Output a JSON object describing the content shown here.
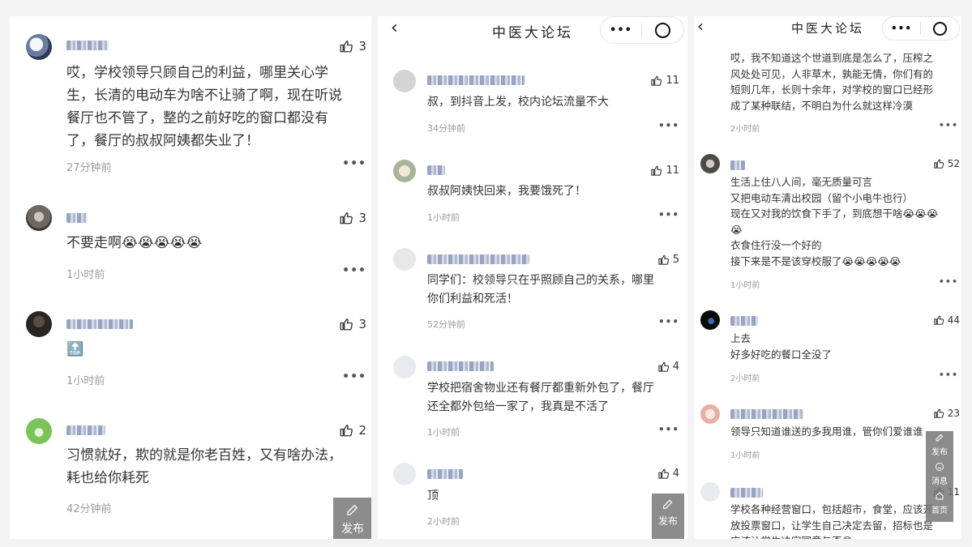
{
  "panel1": {
    "comments": [
      {
        "likes": "3",
        "text": "哎，学校领导只顾自己的利益，哪里关心学\n生，长清的电动车为啥不让骑了啊，现在听说\n餐厅也不管了，整的之前好吃的窗口都没有\n了，餐厅的叔叔阿姨都失业了！",
        "time": "27分钟前"
      },
      {
        "likes": "3",
        "text": "不要走啊😭😭😭😭😭",
        "time": "1小时前"
      },
      {
        "likes": "3",
        "text": "🔝",
        "time": "1小时前"
      },
      {
        "likes": "2",
        "text": "习惯就好，欺的就是你老百姓，又有啥办法，\n耗也给你耗死",
        "time": "42分钟前"
      }
    ],
    "fab": {
      "label": "发布"
    }
  },
  "panel2": {
    "title": "中医大论坛",
    "comments": [
      {
        "likes": "11",
        "text": "叔，到抖音上发，校内论坛流量不大",
        "time": "34分钟前"
      },
      {
        "likes": "11",
        "text": "叔叔阿姨快回来，我要饿死了！",
        "time": "1小时前"
      },
      {
        "likes": "5",
        "text": "同学们：校领导只在乎照顾自己的关系，哪里\n你们利益和死活！",
        "time": "52分钟前"
      },
      {
        "likes": "4",
        "text": "学校把宿舍物业还有餐厅都重新外包了，餐厅\n还全都外包给一家了，我真是不活了",
        "time": "1小时前"
      },
      {
        "likes": "4",
        "text": "顶",
        "time": "2小时前"
      }
    ],
    "fab": {
      "label": "发布"
    }
  },
  "panel3": {
    "title": "中医大论坛",
    "comments": [
      {
        "likes": "",
        "text": "哎，我不知道这个世道到底是怎么了，压榨之\n风处处可见，人非草木，孰能无情，你们有的\n短则几年，长则十余年，对学校的窗口已经形\n成了某种联结，不明白为什么就这样冷漠",
        "time": "2小时前"
      },
      {
        "likes": "52",
        "text": "生活上住八人间，毫无质量可言\n又把电动车清出校园（留个小电牛也行）\n现在又对我的饮食下手了，到底想干啥😭😭😭\n😭\n衣食住行没一个好的\n接下来是不是该穿校服了😭😭😭😭😭",
        "time": "1小时前"
      },
      {
        "likes": "44",
        "text": "上去\n好多好吃的餐口全没了",
        "time": "2小时前"
      },
      {
        "likes": "23",
        "text": "领导只知道谁送的多我用谁，管你们爱谁谁",
        "time": "1小时前"
      },
      {
        "likes": "11",
        "text": "学校各种经营窗口，包括超市，食堂，应该开\n放投票窗口，让学生自己决定去留，招标也是\n应该让学生决定同意与否😡",
        "time": ""
      }
    ],
    "side_menu": {
      "publish": "发布",
      "messages": "消息",
      "home": "首页"
    }
  },
  "icons": {
    "like": "thumbs-up-icon",
    "more": "more-dots-icon",
    "back": "back-chevron-icon",
    "menu": "menu-dots-icon",
    "close": "target-icon",
    "edit": "pencil-icon"
  }
}
